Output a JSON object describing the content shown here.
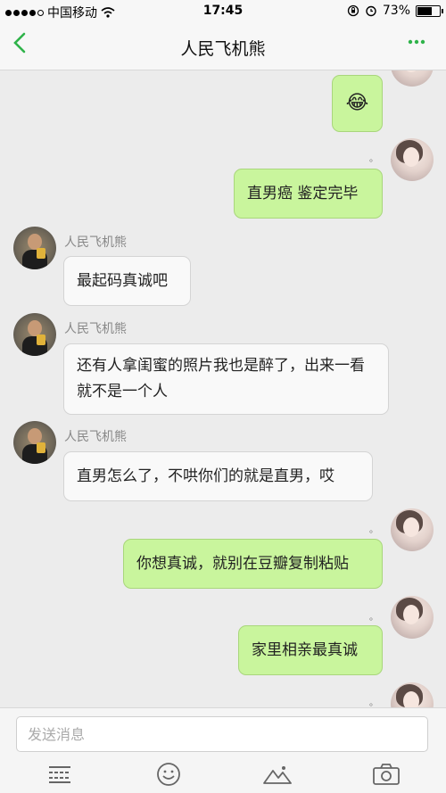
{
  "status_bar": {
    "carrier": "中国移动",
    "time": "17:45",
    "battery_text": "73%",
    "battery_level": 0.73,
    "signal_bars_filled": 4,
    "signal_bars_total": 5
  },
  "header": {
    "title": "人民飞机熊",
    "back_icon": "chevron-left-icon",
    "more_icon": "ellipsis-icon"
  },
  "messages": [
    {
      "side": "out",
      "text": "😂"
    },
    {
      "side": "out",
      "text": "直男癌 鉴定完毕"
    },
    {
      "side": "in",
      "sender": "人民飞机熊",
      "text": "最起码真诚吧"
    },
    {
      "side": "in",
      "sender": "人民飞机熊",
      "text": "还有人拿闺蜜的照片我也是醉了，出来一看就不是一个人"
    },
    {
      "side": "in",
      "sender": "人民飞机熊",
      "text": "直男怎么了，不哄你们的就是直男，哎"
    },
    {
      "side": "out",
      "text": "你想真诚，就别在豆瓣复制粘贴"
    },
    {
      "side": "out",
      "text": "家里相亲最真诚"
    }
  ],
  "input": {
    "placeholder": "发送消息"
  },
  "toolbar": [
    "keyboard-icon",
    "emoji-icon",
    "image-icon",
    "camera-icon"
  ]
}
